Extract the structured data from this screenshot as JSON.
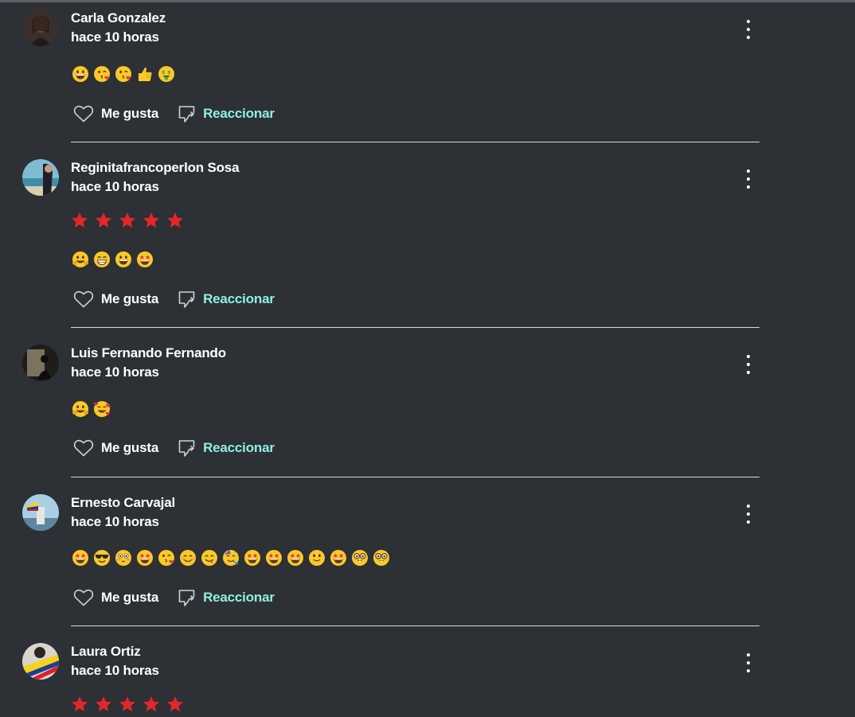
{
  "actions": {
    "like_label": "Me gusta",
    "react_label": "Reaccionar"
  },
  "colors": {
    "background": "#2d3035",
    "text": "#ffffff",
    "react_accent": "#8ff0e3",
    "star": "#e3262c",
    "divider": "#d7d9dc"
  },
  "comments": [
    {
      "author": "Carla Gonzalez",
      "time": "hace 10 horas",
      "rating": 0,
      "emojis": [
        "grinning-face",
        "face-blowing-kiss",
        "face-blowing-kiss",
        "thumbs-up",
        "money-mouth-face"
      ]
    },
    {
      "author": "Reginitafrancoperlon Sosa",
      "time": "hace 10 horas",
      "rating": 5,
      "emojis": [
        "hugging-face",
        "beaming-face",
        "grinning-face",
        "star-struck"
      ]
    },
    {
      "author": "Luis Fernando Fernando",
      "time": "hace 10 horas",
      "rating": 0,
      "emojis": [
        "hugging-face",
        "smiling-face-with-hearts"
      ]
    },
    {
      "author": "Ernesto Carvajal",
      "time": "hace 10 horas",
      "rating": 0,
      "emojis": [
        "star-struck",
        "smiling-face-with-sunglasses",
        "flushed-face",
        "star-struck",
        "face-blowing-kiss",
        "smiling-face",
        "face-savoring-food",
        "partying-face",
        "star-struck",
        "star-struck",
        "star-struck",
        "slightly-smiling-face",
        "star-struck",
        "nerd-face",
        "nerd-face"
      ]
    },
    {
      "author": "Laura Ortiz",
      "time": "hace 10 horas",
      "rating": 5,
      "emojis": []
    }
  ]
}
